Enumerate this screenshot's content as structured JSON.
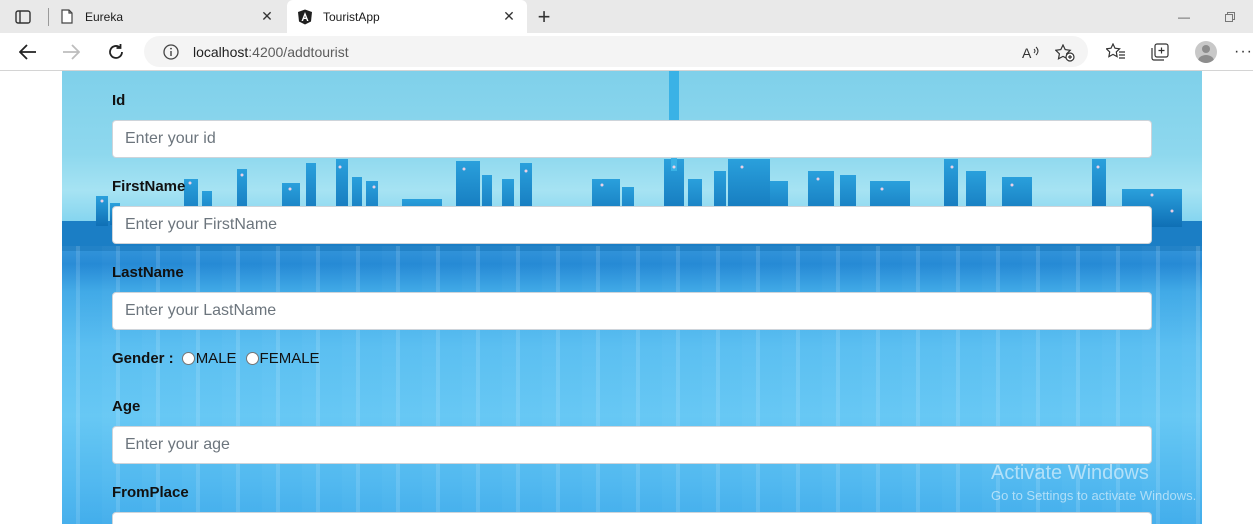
{
  "browser": {
    "tabs": [
      {
        "title": "Eureka",
        "active": false,
        "icon": "page-icon"
      },
      {
        "title": "TouristApp",
        "active": true,
        "icon": "angular-icon"
      }
    ],
    "address": {
      "host": "localhost",
      "path": ":4200/addtourist"
    }
  },
  "form": {
    "id": {
      "label": "Id",
      "placeholder": "Enter your id"
    },
    "firstname": {
      "label": "FirstName",
      "placeholder": "Enter your FirstName"
    },
    "lastname": {
      "label": "LastName",
      "placeholder": "Enter your LastName"
    },
    "gender": {
      "label": "Gender :",
      "options": [
        "MALE",
        "FEMALE"
      ]
    },
    "age": {
      "label": "Age",
      "placeholder": "Enter your age"
    },
    "fromplace": {
      "label": "FromPlace",
      "placeholder": ""
    }
  },
  "watermark": {
    "line1": "Activate Windows",
    "line2": "Go to Settings to activate Windows."
  }
}
